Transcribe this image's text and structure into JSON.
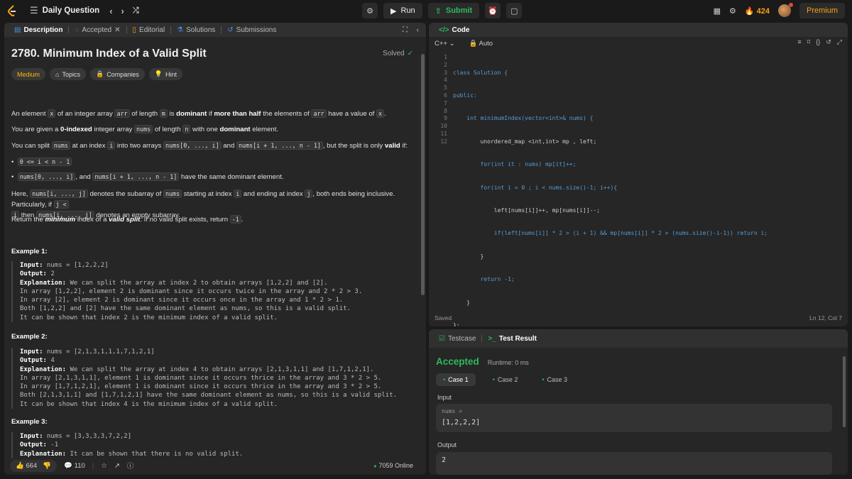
{
  "topbar": {
    "title": "Daily Question",
    "run_label": "Run",
    "submit_label": "Submit",
    "streak_count": "424",
    "premium_label": "Premium"
  },
  "left_tabs": [
    {
      "label": "Description",
      "icon": "description-icon"
    },
    {
      "label": "Accepted",
      "icon": "accepted-icon"
    },
    {
      "label": "Editorial",
      "icon": "book-icon"
    },
    {
      "label": "Solutions",
      "icon": "flask-icon"
    },
    {
      "label": "Submissions",
      "icon": "history-icon"
    }
  ],
  "problem": {
    "title": "2780. Minimum Index of a Valid Split",
    "solved_label": "Solved",
    "difficulty": "Medium",
    "topics_label": "Topics",
    "companies_label": "Companies",
    "hint_label": "Hint"
  },
  "description": {
    "p1": {
      "a": "An element",
      "x": "x",
      "b": "of an integer array",
      "arr": "arr",
      "c": "of length",
      "m": "m",
      "d": "is",
      "dominant": "dominant",
      "e": "if",
      "more_than_half": "more than half",
      "f": "the elements of",
      "arr2": "arr",
      "g": "have a value of",
      "x2": "x",
      "h": "."
    },
    "p2": {
      "a": "You are given a",
      "zero_indexed": "0-indexed",
      "b": "integer array",
      "nums": "nums",
      "c": "of length",
      "n": "n",
      "d": "with one",
      "dominant": "dominant",
      "e": "element."
    },
    "p3": {
      "a": "You can split",
      "nums": "nums",
      "b": "at an index",
      "i": "i",
      "c": "into two arrays",
      "left": "nums[0, ..., i]",
      "d": "and",
      "right": "nums[i + 1, ..., n - 1]",
      "e": ", but the split is only",
      "valid": "valid",
      "f": "if:"
    },
    "bullet1": "0 <= i < n - 1",
    "bullet2": {
      "left": "nums[0, ..., i]",
      "a": ", and",
      "right": "nums[i + 1, ..., n - 1]",
      "b": "have the same dominant element."
    },
    "p4": {
      "a": "Here,",
      "sub": "nums[i, ..., j]",
      "b": "denotes the subarray of",
      "nums": "nums",
      "c": "starting at index",
      "i": "i",
      "d": "and ending at index",
      "j": "j",
      "e": ", both ends being inclusive. Particularly, if",
      "cond": "j <",
      "cond2": "i",
      "f": "then",
      "sub2": "nums[i, ..., j]",
      "g": "denotes an empty subarray."
    },
    "p5": {
      "a": "Return the",
      "minimum": "minimum",
      "b": "index of a",
      "valid_split": "valid split",
      "c": ". If no valid split exists, return",
      "neg": "-1",
      "d": "."
    }
  },
  "examples": [
    {
      "title": "Example 1:",
      "input_label": "Input:",
      "input": " nums = [1,2,2,2]",
      "output_label": "Output:",
      "output": " 2",
      "explanation_label": "Explanation:",
      "explanation": " We can split the array at index 2 to obtain arrays [1,2,2] and [2].\nIn array [1,2,2], element 2 is dominant since it occurs twice in the array and 2 * 2 > 3.\nIn array [2], element 2 is dominant since it occurs once in the array and 1 * 2 > 1.\nBoth [1,2,2] and [2] have the same dominant element as nums, so this is a valid split.\nIt can be shown that index 2 is the minimum index of a valid split."
    },
    {
      "title": "Example 2:",
      "input_label": "Input:",
      "input": " nums = [2,1,3,1,1,1,7,1,2,1]",
      "output_label": "Output:",
      "output": " 4",
      "explanation_label": "Explanation:",
      "explanation": " We can split the array at index 4 to obtain arrays [2,1,3,1,1] and [1,7,1,2,1].\nIn array [2,1,3,1,1], element 1 is dominant since it occurs thrice in the array and 3 * 2 > 5.\nIn array [1,7,1,2,1], element 1 is dominant since it occurs thrice in the array and 3 * 2 > 5.\nBoth [2,1,3,1,1] and [1,7,1,2,1] have the same dominant element as nums, so this is a valid split.\nIt can be shown that index 4 is the minimum index of a valid split."
    },
    {
      "title": "Example 3:",
      "input_label": "Input:",
      "input": " nums = [3,3,3,3,7,2,2]",
      "output_label": "Output:",
      "output": " -1",
      "explanation_label": "Explanation:",
      "explanation": " It can be shown that there is no valid split."
    }
  ],
  "footer": {
    "likes": "664",
    "comments": "110",
    "online": "7059 Online"
  },
  "code": {
    "tab_label": "Code",
    "language": "C++",
    "mode": "Auto",
    "line_numbers": [
      "1",
      "2",
      "3",
      "4",
      "5",
      "6",
      "7",
      "8",
      "9",
      "10",
      "11",
      "12"
    ],
    "lines": [
      "class Solution {",
      "public:",
      "    int minimumIndex(vector<int>& nums) {",
      "        unordered_map <int,int> mp , left;",
      "        for(int it : nums) mp[it]++;",
      "        for(int i = 0 ; i < nums.size()-1; i++){",
      "            left[nums[i]]++, mp[nums[i]]--;",
      "            if(left[nums[i]] * 2 > (i + 1) && mp[nums[i]] * 2 > (nums.size()-i-1)) return i;",
      "        }",
      "        return -1;",
      "    }",
      "};"
    ],
    "status": "Saved",
    "cursor": "Ln 12, Col 7"
  },
  "test": {
    "testcase_label": "Testcase",
    "result_label": "Test Result",
    "verdict": "Accepted",
    "runtime": "Runtime: 0 ms",
    "cases": [
      "Case 1",
      "Case 2",
      "Case 3"
    ],
    "input_label": "Input",
    "input_var": "nums =",
    "input_value": "[1,2,2,2]",
    "output_label": "Output",
    "output_value": "2"
  },
  "colors": {
    "accent": "#ffa116",
    "green": "#2cbb5d",
    "blue": "#4a90e2",
    "bg": "#1a1a1a",
    "panel": "#262626"
  }
}
